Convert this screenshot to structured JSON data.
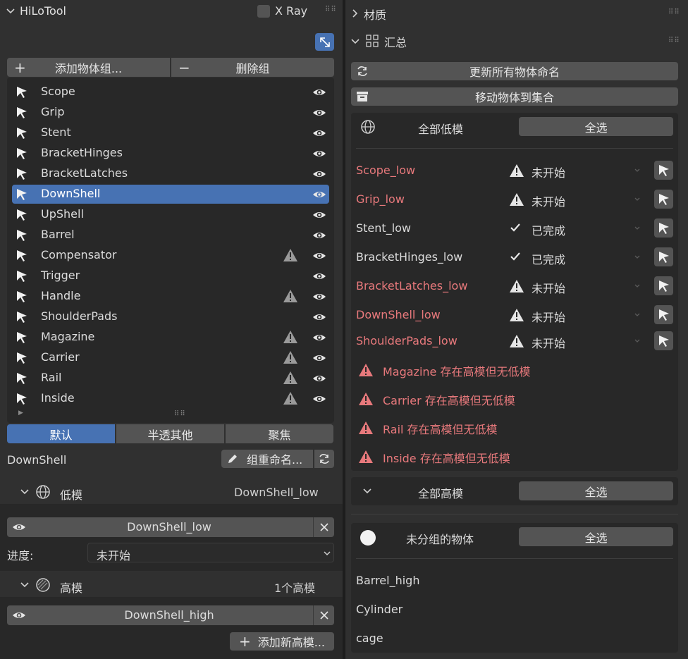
{
  "left": {
    "header": {
      "title": "HiLoTool",
      "xray_label": "X Ray"
    },
    "group_buttons": {
      "add": "添加物体组...",
      "delete": "删除组"
    },
    "objects": [
      {
        "name": "Scope",
        "warn": false
      },
      {
        "name": "Grip",
        "warn": false
      },
      {
        "name": "Stent",
        "warn": false
      },
      {
        "name": "BracketHinges",
        "warn": false
      },
      {
        "name": "BracketLatches",
        "warn": false
      },
      {
        "name": "DownShell",
        "warn": false,
        "selected": true
      },
      {
        "name": "UpShell",
        "warn": false
      },
      {
        "name": "Barrel",
        "warn": false
      },
      {
        "name": "Compensator",
        "warn": true
      },
      {
        "name": "Trigger",
        "warn": false
      },
      {
        "name": "Handle",
        "warn": true
      },
      {
        "name": "ShoulderPads",
        "warn": false
      },
      {
        "name": "Magazine",
        "warn": true
      },
      {
        "name": "Carrier",
        "warn": true
      },
      {
        "name": "Rail",
        "warn": true
      },
      {
        "name": "Inside",
        "warn": true
      }
    ],
    "view_tabs": [
      "默认",
      "半透其他",
      "聚焦"
    ],
    "active_group": "DownShell",
    "rename_button": "组重命名...",
    "low_section": {
      "title": "低模",
      "value": "DownShell_low",
      "field": "DownShell_low",
      "progress_label": "进度:",
      "progress_value": "未开始"
    },
    "high_section": {
      "title": "高模",
      "count": "1个高模",
      "field": "DownShell_high",
      "add_button": "添加新高模..."
    }
  },
  "right": {
    "material_title": "材质",
    "summary_title": "汇总",
    "update_names_button": "更新所有物体命名",
    "move_to_collection_button": "移动物体到集合",
    "all_low": {
      "title": "全部低模",
      "select_all": "全选",
      "items": [
        {
          "name": "Scope_low",
          "status": "未开始",
          "done": false
        },
        {
          "name": "Grip_low",
          "status": "未开始",
          "done": false
        },
        {
          "name": "Stent_low",
          "status": "已完成",
          "done": true
        },
        {
          "name": "BracketHinges_low",
          "status": "已完成",
          "done": true
        },
        {
          "name": "BracketLatches_low",
          "status": "未开始",
          "done": false
        },
        {
          "name": "DownShell_low",
          "status": "未开始",
          "done": false
        },
        {
          "name": "ShoulderPads_low",
          "status": "未开始",
          "done": false
        }
      ],
      "warnings": [
        "Magazine 存在高模但无低模",
        "Carrier 存在高模但无低模",
        "Rail 存在高模但无低模",
        "Inside 存在高模但无低模"
      ]
    },
    "all_high": {
      "title": "全部高模",
      "select_all": "全选"
    },
    "ungrouped": {
      "title": "未分组的物体",
      "select_all": "全选",
      "items": [
        "Barrel_high",
        "Cylinder",
        "cage"
      ]
    }
  },
  "colors": {
    "accent": "#4772b3",
    "warning_text": "#e8797c",
    "button": "#545454",
    "panel": "#303030"
  }
}
